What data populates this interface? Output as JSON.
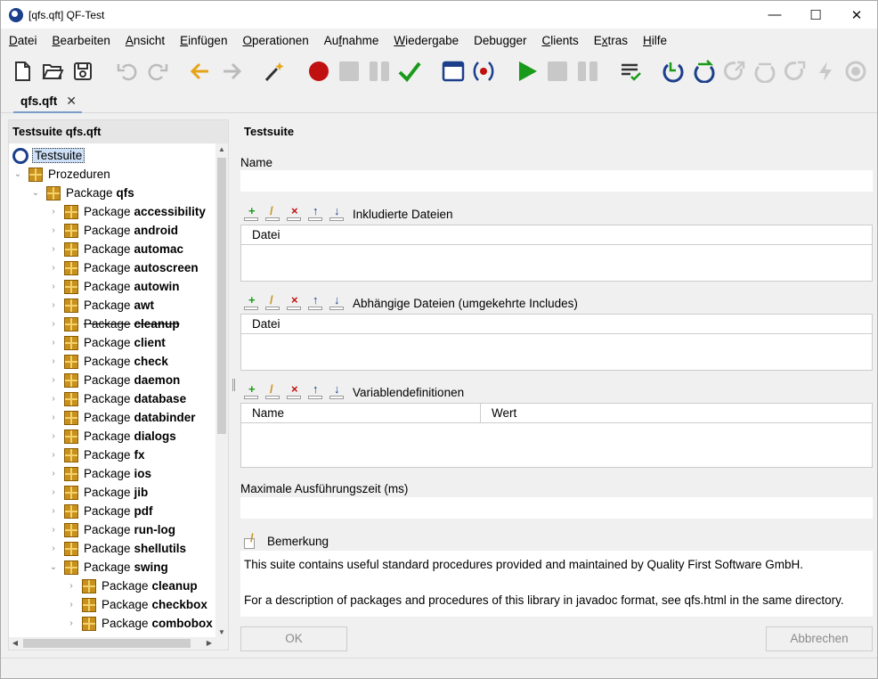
{
  "window": {
    "title": "[qfs.qft] QF-Test",
    "controls": [
      "—",
      "☐",
      "✕"
    ]
  },
  "menu": [
    {
      "label": "Datei",
      "mnemonic": "D"
    },
    {
      "label": "Bearbeiten",
      "mnemonic": "B"
    },
    {
      "label": "Ansicht",
      "mnemonic": "A"
    },
    {
      "label": "Einfügen",
      "mnemonic": "E"
    },
    {
      "label": "Operationen",
      "mnemonic": "O"
    },
    {
      "label": "Aufnahme",
      "mnemonic": "f"
    },
    {
      "label": "Wiedergabe",
      "mnemonic": "W"
    },
    {
      "label": "Debugger",
      "mnemonic": "g"
    },
    {
      "label": "Clients",
      "mnemonic": "C"
    },
    {
      "label": "Extras",
      "mnemonic": "x"
    },
    {
      "label": "Hilfe",
      "mnemonic": "H"
    }
  ],
  "toolbar": {
    "icons": [
      "new-file-icon",
      "open-folder-icon",
      "save-icon",
      "undo-icon",
      "redo-icon",
      "back-arrow-icon",
      "forward-arrow-icon",
      "magic-wand-icon",
      "record-icon",
      "stop-record-icon",
      "pause-record-icon",
      "check-icon",
      "window-icon",
      "record-component-icon",
      "play-icon",
      "stop-icon",
      "pause-icon",
      "checklist-icon",
      "step-in-icon",
      "step-over-icon",
      "step-out-icon",
      "skip-over-icon",
      "skip-out-icon",
      "continue-icon",
      "breakpoint-icon"
    ]
  },
  "tabs": [
    {
      "label": "qfs.qft",
      "close": "✕"
    }
  ],
  "tree": {
    "header": "Testsuite qfs.qft",
    "root": "Testsuite",
    "procedures": "Prozeduren",
    "package_prefix": "Package",
    "main_package": "qfs",
    "packages": [
      "accessibility",
      "android",
      "automac",
      "autoscreen",
      "autowin",
      "awt",
      "cleanup",
      "client",
      "check",
      "daemon",
      "database",
      "databinder",
      "dialogs",
      "fx",
      "ios",
      "jib",
      "pdf",
      "run-log",
      "shellutils",
      "swing"
    ],
    "struck_packages": [
      "cleanup"
    ],
    "swing_children": [
      "cleanup",
      "checkbox",
      "combobox"
    ]
  },
  "detail": {
    "title": "Testsuite",
    "name_label": "Name",
    "name_value": "",
    "included_label": "Inkludierte Dateien",
    "included_columns": [
      "Datei"
    ],
    "dependent_label": "Abhängige Dateien (umgekehrte Includes)",
    "dependent_columns": [
      "Datei"
    ],
    "variables_label": "Variablendefinitionen",
    "variables_columns": [
      "Name",
      "Wert"
    ],
    "max_time_label": "Maximale Ausführungszeit (ms)",
    "max_time_value": "",
    "comment_label": "Bemerkung",
    "comment_line1": "This suite contains useful standard procedures provided and maintained by Quality First Software GmbH.",
    "comment_line2": "For a description of packages and procedures of this library in javadoc format, see qfs.html in the same directory.",
    "ok_label": "OK",
    "cancel_label": "Abbrechen"
  },
  "colors": {
    "accent": "#1c3f8c",
    "record": "#c01010",
    "play": "#1a9a1a",
    "nav_arrow": "#e6a419"
  }
}
